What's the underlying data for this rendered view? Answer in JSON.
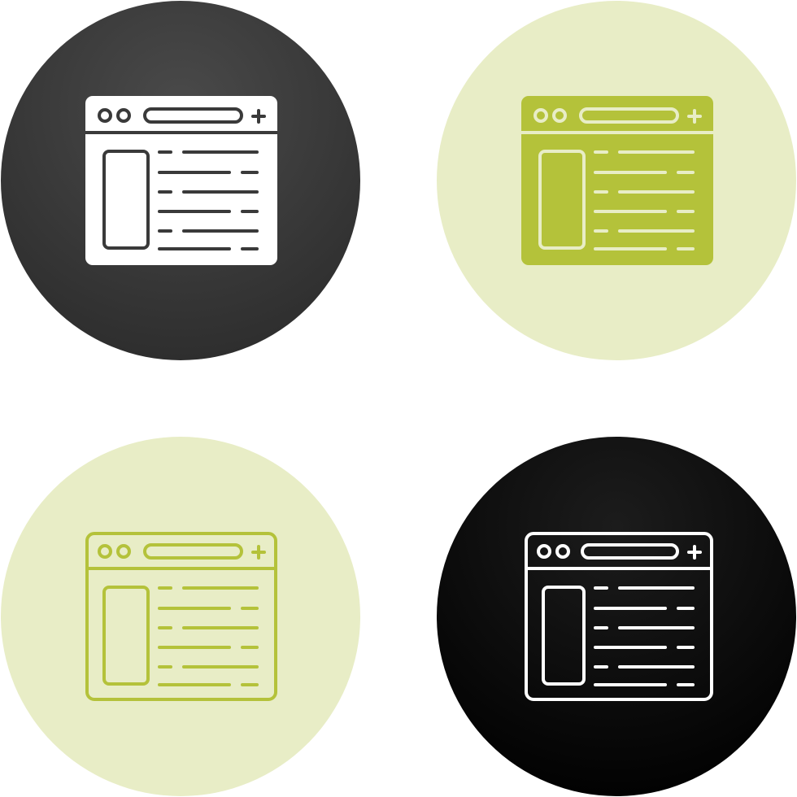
{
  "colors": {
    "page_background": "#ffffff",
    "dark_gray_circle": "#3a3a3a",
    "dark_gray_circle_highlight": "#4a4a4a",
    "black_circle": "#050505",
    "black_circle_highlight": "#1c1c1c",
    "pale_green_circle": "#e8edc6",
    "lime_green": "#b4c23a",
    "white": "#ffffff"
  },
  "icons": [
    {
      "name": "browser-window-icon",
      "variant": "glyph-white-on-dark-gray"
    },
    {
      "name": "browser-window-icon",
      "variant": "glyph-green-on-pale-green"
    },
    {
      "name": "browser-window-icon",
      "variant": "outline-green-on-pale-green"
    },
    {
      "name": "browser-window-icon",
      "variant": "outline-white-on-black"
    }
  ]
}
